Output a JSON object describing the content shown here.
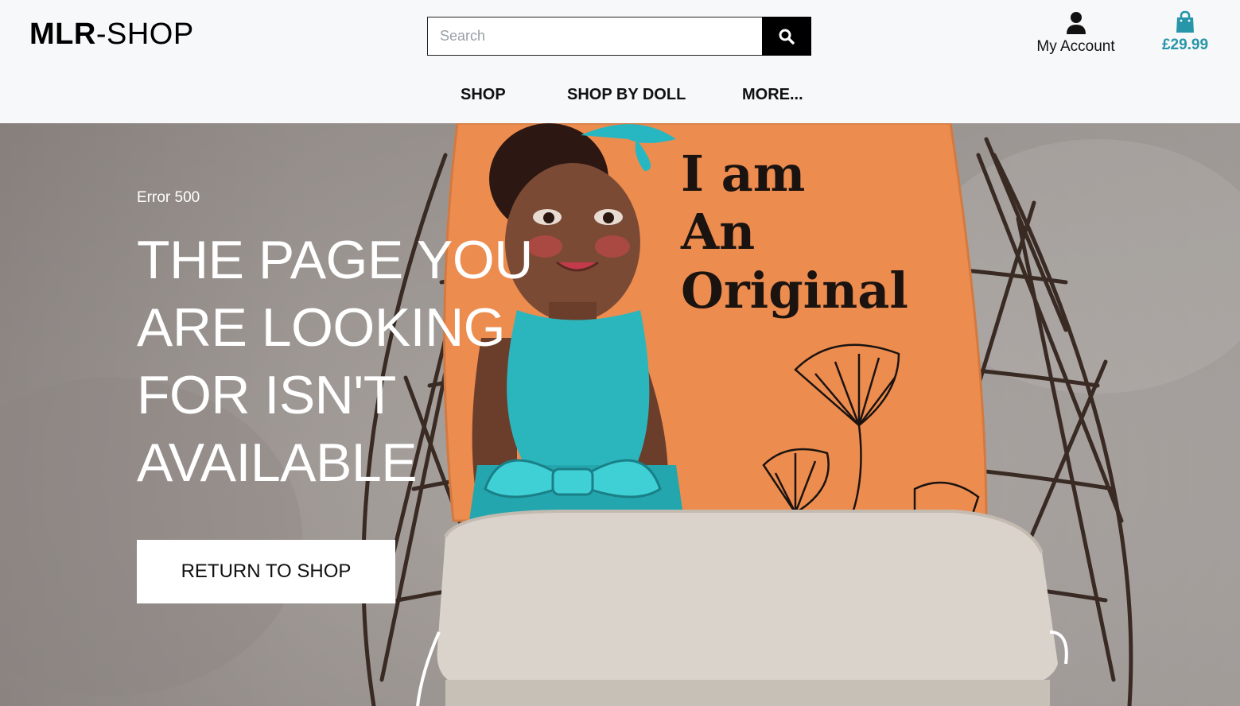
{
  "header": {
    "logo_bold": "MLR",
    "logo_rest": "-SHOP",
    "search": {
      "placeholder": "Search",
      "value": ""
    },
    "account_label": "My Account",
    "bag_total": "£29.99",
    "accent_color": "#2696a8"
  },
  "nav": {
    "items": [
      {
        "label": "SHOP"
      },
      {
        "label": "SHOP BY DOLL"
      },
      {
        "label": "MORE..."
      }
    ]
  },
  "hero": {
    "error_code": "Error 500",
    "headline": "THE PAGE YOU ARE LOOKING FOR ISN'T AVAILABLE",
    "cta_label": "RETURN TO SHOP",
    "pillow_text": [
      "I am",
      "An",
      "Original"
    ]
  },
  "icons": {
    "search": "search-icon",
    "account": "user-icon",
    "bag": "shopping-bag-icon"
  }
}
